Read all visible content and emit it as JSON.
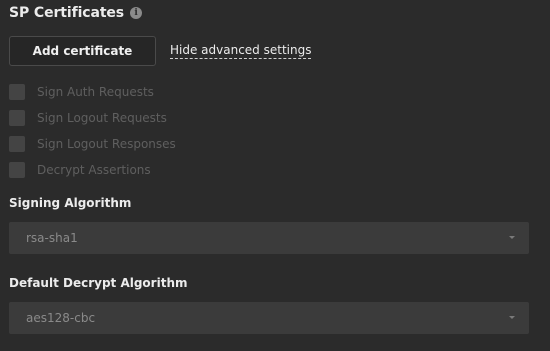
{
  "section": {
    "title": "SP Certificates",
    "info_icon": "info-icon"
  },
  "actions": {
    "add_certificate_label": "Add certificate",
    "hide_advanced_label": "Hide advanced settings"
  },
  "options": [
    {
      "label": "Sign Auth Requests",
      "checked": false,
      "disabled": true
    },
    {
      "label": "Sign Logout Requests",
      "checked": false,
      "disabled": true
    },
    {
      "label": "Sign Logout Responses",
      "checked": false,
      "disabled": true
    },
    {
      "label": "Decrypt Assertions",
      "checked": false,
      "disabled": true
    }
  ],
  "signing_algorithm": {
    "label": "Signing Algorithm",
    "value": "rsa-sha1"
  },
  "decrypt_algorithm": {
    "label": "Default Decrypt Algorithm",
    "value": "aes128-cbc"
  },
  "colors": {
    "background": "#2b2b2b",
    "select_background": "#3b3b3b",
    "disabled_text": "#5f5f5f"
  }
}
